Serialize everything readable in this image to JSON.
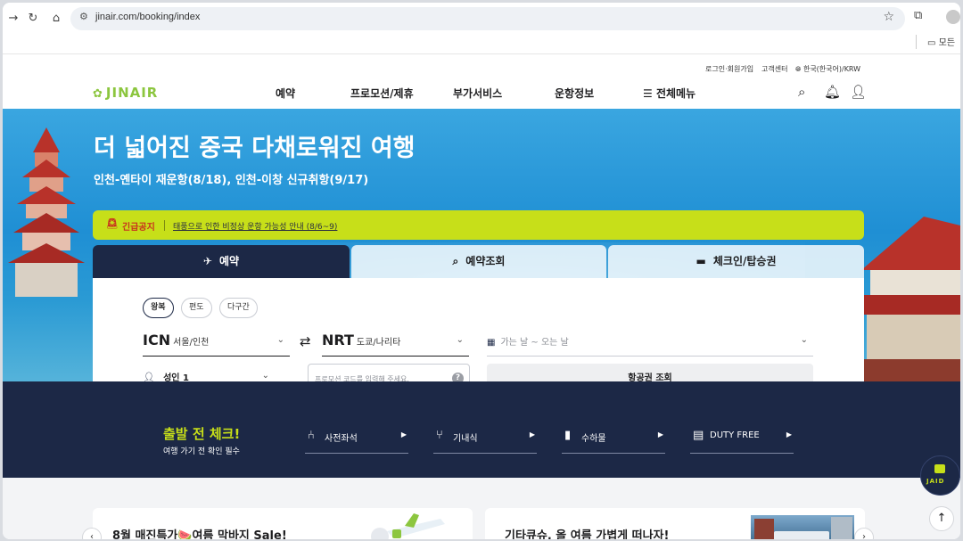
{
  "browser": {
    "url": "jinair.com/booking/index",
    "bookmarks_label": "모든"
  },
  "utility": {
    "login": "로그인·회원가입",
    "support": "고객센터",
    "locale": "한국(한국어)/KRW"
  },
  "logo": {
    "text": "JINAIR"
  },
  "gnb": [
    {
      "label": "예약"
    },
    {
      "label": "프로모션/제휴"
    },
    {
      "label": "부가서비스"
    },
    {
      "label": "운항정보"
    },
    {
      "label": "전체메뉴"
    }
  ],
  "hero": {
    "title": "더 넓어진 중국 다채로워진 여행",
    "subtitle": "인천-옌타이 재운항(8/18), 인천-이창 신규취항(9/17)"
  },
  "notice": {
    "tag": "긴급공지",
    "text": "태풍으로 인한 비정상 운항 가능성 안내 (8/6~9)"
  },
  "booking": {
    "tabs": [
      {
        "label": "예약",
        "icon": "plane-icon",
        "active": true
      },
      {
        "label": "예약조회",
        "icon": "search-icon",
        "active": false
      },
      {
        "label": "체크인/탑승권",
        "icon": "ticket-icon",
        "active": false
      }
    ],
    "trip_types": [
      {
        "label": "왕복",
        "selected": true
      },
      {
        "label": "편도",
        "selected": false
      },
      {
        "label": "다구간",
        "selected": false
      }
    ],
    "origin": {
      "code": "ICN",
      "city": "서울/인천"
    },
    "destination": {
      "code": "NRT",
      "city": "도쿄/나리타"
    },
    "date_placeholder": "가는 날 ~ 오는 날",
    "passengers": "성인 1",
    "promo_placeholder": "프로모션 코드를 입력해 주세요.",
    "promo_help": "?",
    "search_label": "항공권 조회"
  },
  "departure_check": {
    "title": "출발 전 체크!",
    "subtitle": "여행 가기 전 확인 필수",
    "items": [
      {
        "label": "사전좌석",
        "icon": "seat-icon"
      },
      {
        "label": "기내식",
        "icon": "meal-icon"
      },
      {
        "label": "수하물",
        "icon": "baggage-icon"
      },
      {
        "label": "DUTY FREE",
        "icon": "duty-free-icon"
      }
    ]
  },
  "jaid": {
    "label": "JAID"
  },
  "promos": [
    {
      "title": "8월 매진특가🍉여름 막바지 Sale!"
    },
    {
      "title": "기타큐슈, 올 여름 가볍게 떠나자!"
    }
  ],
  "colors": {
    "navy": "#1c2846",
    "lime": "#c7df19",
    "brand_green": "#8cc63f",
    "alert_red": "#c8321e"
  }
}
